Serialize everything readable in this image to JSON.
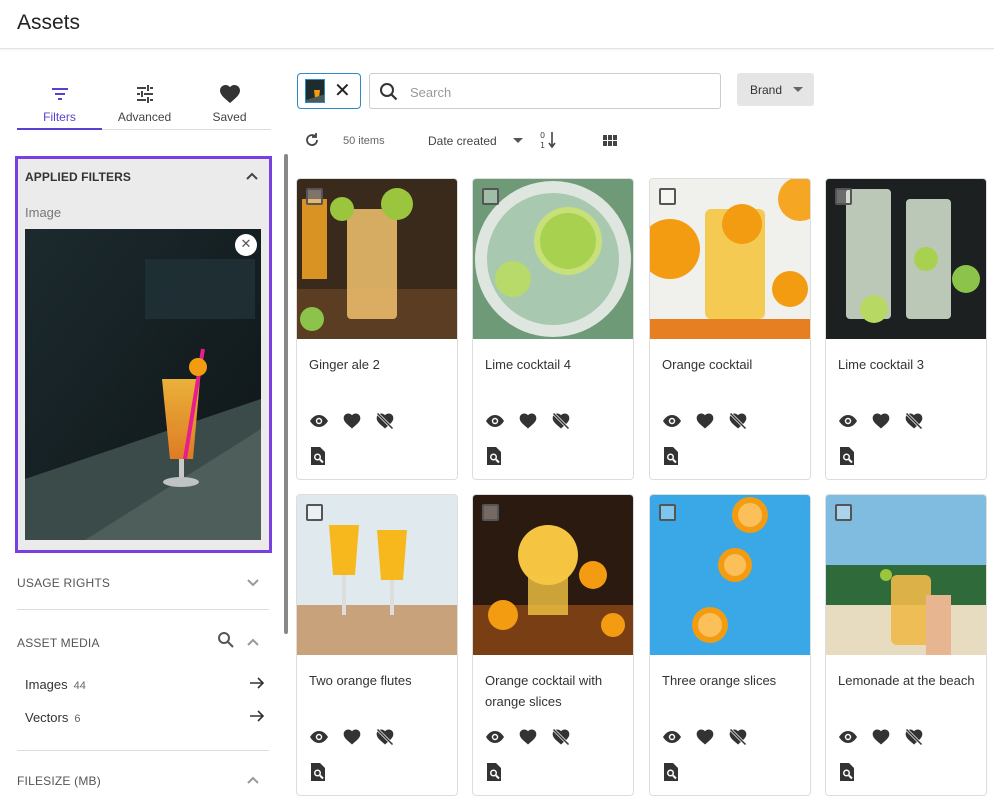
{
  "header": {
    "title": "Assets"
  },
  "tabs": [
    {
      "label": "Filters"
    },
    {
      "label": "Advanced"
    },
    {
      "label": "Saved"
    }
  ],
  "applied_filters": {
    "heading": "APPLIED FILTERS",
    "image_label": "Image"
  },
  "facets": {
    "usage_rights": "USAGE RIGHTS",
    "asset_media": "ASSET MEDIA",
    "media_items": [
      {
        "label": "Images",
        "count": "44"
      },
      {
        "label": "Vectors",
        "count": "6"
      }
    ],
    "filesize": "FILESIZE (MB)"
  },
  "search": {
    "placeholder": "Search",
    "value": ""
  },
  "brand_dropdown": {
    "label": "Brand"
  },
  "toolbar": {
    "item_count": "50 items",
    "sort_label": "Date created"
  },
  "assets": [
    {
      "title": "Ginger ale 2"
    },
    {
      "title": "Lime cocktail 4"
    },
    {
      "title": "Orange cocktail"
    },
    {
      "title": "Lime cocktail 3"
    },
    {
      "title": "Two orange flutes"
    },
    {
      "title": "Orange cocktail with orange slices"
    },
    {
      "title": "Three orange slices"
    },
    {
      "title": "Lemonade at the beach"
    }
  ],
  "colors": {
    "accent": "#5b3fd1",
    "highlight_border": "#7a3fe0",
    "chip_border": "#2c8ac4"
  }
}
